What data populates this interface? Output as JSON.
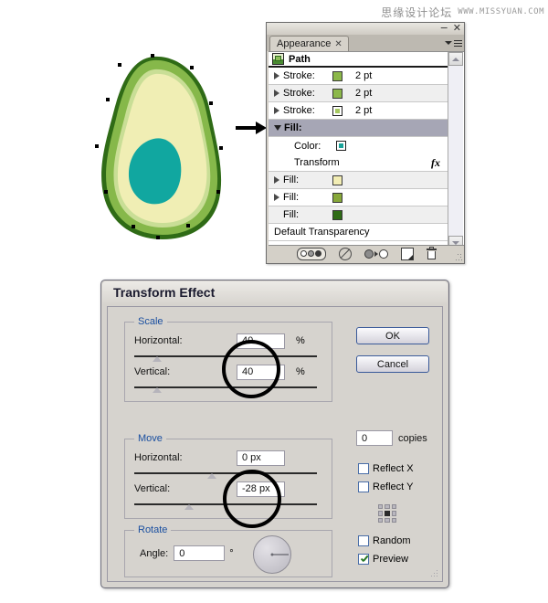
{
  "watermark": {
    "chinese": "思缘设计论坛",
    "url": "WWW.MISSYUAN.COM"
  },
  "illustration": {
    "name": "avocado-half",
    "outline_color": "#3c6b1f",
    "skin_color": "#86b84a",
    "flesh_color": "#f0eeb4",
    "pit_color": "#11a7a0"
  },
  "arrow": {
    "name": "flow-arrow",
    "direction": "right"
  },
  "appearance_panel": {
    "tab_label": "Appearance",
    "tab_close": "✕",
    "minimize_label": "−",
    "close_label": "✕",
    "target_label": "Path",
    "rows": [
      {
        "label": "Stroke:",
        "value": "2 pt",
        "swatch": "#8cb84a",
        "disclosure": "closed",
        "ringed": false
      },
      {
        "label": "Stroke:",
        "value": "2 pt",
        "swatch": "#8cb84a",
        "disclosure": "closed",
        "ringed": false
      },
      {
        "label": "Stroke:",
        "value": "2 pt",
        "swatch": "#a6c85f",
        "disclosure": "closed",
        "ringed": true
      },
      {
        "label": "Fill:",
        "value": "",
        "swatch": "",
        "disclosure": "open",
        "ringed": false
      },
      {
        "label": "Color:",
        "value": "",
        "swatch": "#1aa39a",
        "disclosure": "none",
        "ringed": true
      },
      {
        "label": "Transform",
        "value": "",
        "swatch": "",
        "disclosure": "none",
        "ringed": false
      },
      {
        "label": "Fill:",
        "value": "",
        "swatch": "#f2edb4",
        "disclosure": "closed",
        "ringed": false
      },
      {
        "label": "Fill:",
        "value": "",
        "swatch": "#87a83a",
        "disclosure": "closed",
        "ringed": false
      },
      {
        "label": "Fill:",
        "value": "",
        "swatch": "#2f6b16",
        "disclosure": "none",
        "ringed": false
      },
      {
        "label": "Default Transparency",
        "value": "",
        "swatch": "",
        "disclosure": "none",
        "ringed": false
      }
    ],
    "fx_label": "fx",
    "footer_icons": [
      "opacity-appearance-icon",
      "clear-appearance-icon",
      "reduce-to-basic-appearance-icon",
      "duplicate-item-icon",
      "delete-item-icon"
    ]
  },
  "transform_dialog": {
    "title": "Transform Effect",
    "scale": {
      "legend": "Scale",
      "horizontal_label": "Horizontal:",
      "horizontal_value": "40",
      "horizontal_unit": "%",
      "vertical_label": "Vertical:",
      "vertical_value": "40",
      "vertical_unit": "%"
    },
    "move": {
      "legend": "Move",
      "horizontal_label": "Horizontal:",
      "horizontal_value": "0 px",
      "vertical_label": "Vertical:",
      "vertical_value": "-28 px"
    },
    "rotate": {
      "legend": "Rotate",
      "angle_label": "Angle:",
      "angle_value": "0",
      "angle_unit": "°"
    },
    "buttons": {
      "ok": "OK",
      "cancel": "Cancel"
    },
    "copies_value": "0",
    "copies_label": "copies",
    "reflect_x_label": "Reflect X",
    "reflect_y_label": "Reflect Y",
    "random_label": "Random",
    "preview_label": "Preview",
    "reflect_x_checked": false,
    "reflect_y_checked": false,
    "random_checked": false,
    "preview_checked": true,
    "anchor_selected": "center"
  }
}
